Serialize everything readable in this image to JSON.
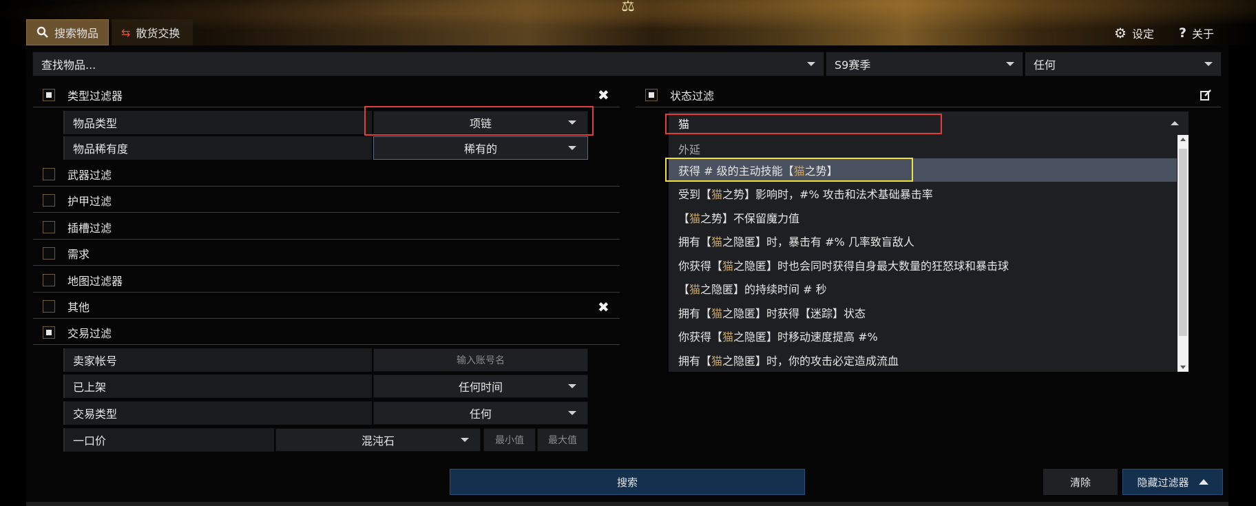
{
  "header": {
    "tabs": [
      {
        "label": "搜索物品",
        "icon": "search-icon"
      },
      {
        "label": "散货交换",
        "icon": "exchange-icon"
      }
    ],
    "settings_label": "设定",
    "about_label": "关于"
  },
  "search_bar": {
    "item_placeholder": "查找物品...",
    "league": "S9赛季",
    "status": "任何"
  },
  "type_filters": {
    "title": "类型过滤器",
    "item_type_label": "物品类型",
    "item_type_value": "项链",
    "rarity_label": "物品稀有度",
    "rarity_value": "稀有的"
  },
  "filter_groups": [
    "武器过滤",
    "护甲过滤",
    "插槽过滤",
    "需求",
    "地图过滤器",
    "其他"
  ],
  "trade_filters": {
    "title": "交易过滤",
    "seller_label": "卖家帐号",
    "seller_placeholder": "输入账号名",
    "listed_label": "已上架",
    "listed_value": "任何时间",
    "sale_type_label": "交易类型",
    "sale_type_value": "任何",
    "buyout_label": "一口价",
    "currency_value": "混沌石",
    "min_placeholder": "最小值",
    "max_placeholder": "最大值"
  },
  "stat_filters": {
    "title": "状态过滤",
    "query": "猫",
    "dropdown_header": "外延",
    "options": [
      [
        "获得 # 级的主动技能【",
        "猫",
        "之势】"
      ],
      [
        "受到【",
        "猫",
        "之势】影响时，#% 攻击和法术基础暴击率"
      ],
      [
        "【",
        "猫",
        "之势】不保留魔力值"
      ],
      [
        "拥有【",
        "猫",
        "之隐匿】时，暴击有 #% 几率致盲敌人"
      ],
      [
        "你获得【",
        "猫",
        "之隐匿】时也会同时获得自身最大数量的狂怒球和暴击球"
      ],
      [
        "【",
        "猫",
        "之隐匿】的持续时间 # 秒"
      ],
      [
        "拥有【",
        "猫",
        "之隐匿】时获得【迷踪】状态"
      ],
      [
        "你获得【",
        "猫",
        "之隐匿】时移动速度提高 #%"
      ],
      [
        "拥有【",
        "猫",
        "之隐匿】时，你的攻击必定造成流血"
      ]
    ]
  },
  "actions": {
    "search_label": "搜索",
    "clear_label": "清除",
    "hide_filters_label": "隐藏过滤器"
  },
  "colors": {
    "accent_gold": "#c9a25c",
    "highlight_red": "#e53b3b",
    "highlight_yellow": "#f0e040",
    "search_button": "#13304f"
  }
}
